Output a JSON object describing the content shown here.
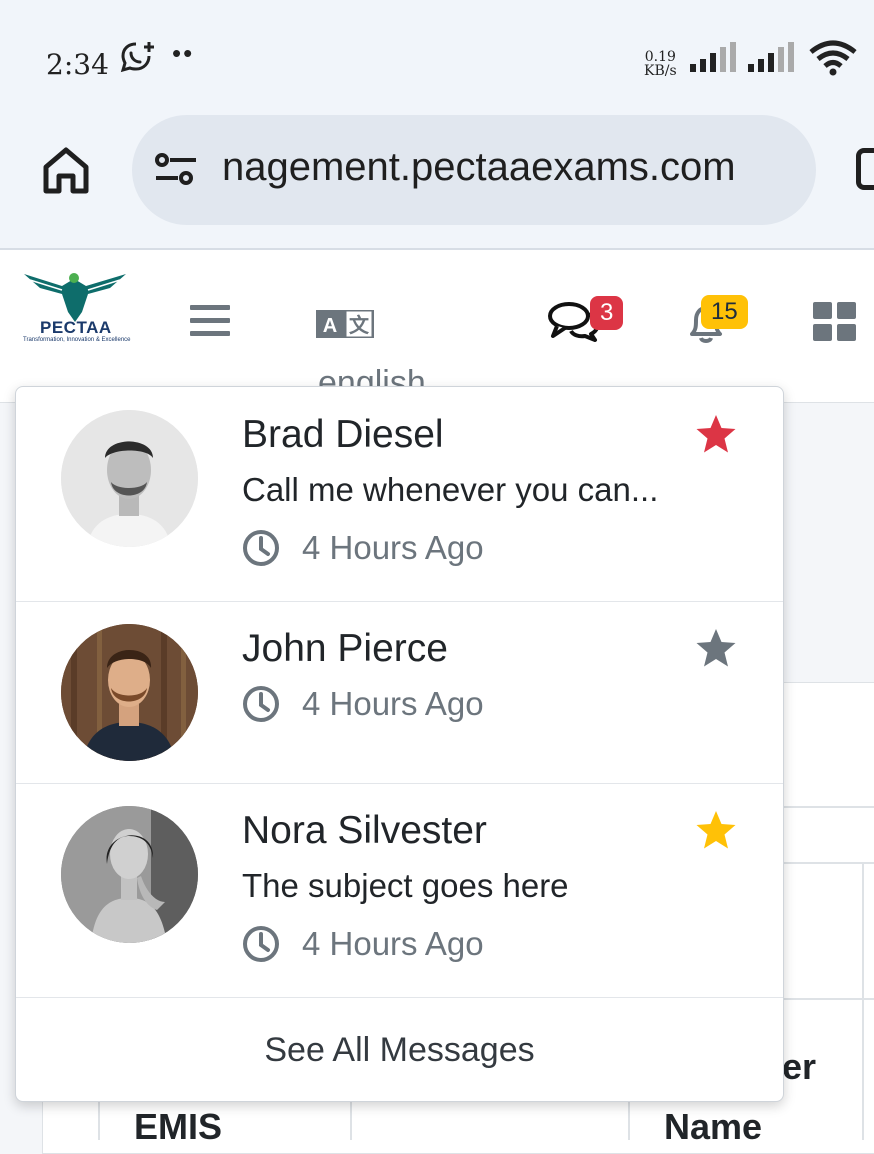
{
  "status_bar": {
    "time": "2:34",
    "dots": "••",
    "speed_value": "0.19",
    "speed_unit": "KB/s",
    "icons": [
      "whatsapp-icon",
      "signal-icon",
      "signal-icon",
      "wifi-icon"
    ]
  },
  "browser": {
    "url": "nagement.pectaaexams.com",
    "icons": [
      "home-icon",
      "tune-icon",
      "tabs-icon"
    ]
  },
  "navbar": {
    "logo_text": "PECTAA",
    "logo_tagline": "Transformation, Innovation & Excellence",
    "language_label": "english",
    "messages_badge": "3",
    "notifications_badge": "15",
    "icons": [
      "menu-icon",
      "translate-icon",
      "chat-icon",
      "bell-icon",
      "apps-grid-icon"
    ]
  },
  "messages_dropdown": {
    "items": [
      {
        "name": "Brad Diesel",
        "subject": "Call me whenever you can...",
        "time": "4 Hours Ago",
        "star_color": "#dc3545"
      },
      {
        "name": "John Pierce",
        "subject": "",
        "time": "4 Hours Ago",
        "star_color": "#6c757d"
      },
      {
        "name": "Nora Silvester",
        "subject": "The subject goes here",
        "time": "4 Hours Ago",
        "star_color": "#ffc107"
      }
    ],
    "footer": "See All Messages"
  },
  "background_table": {
    "header_1": "EMIS",
    "header_2_top": "er",
    "header_2": "Name"
  }
}
